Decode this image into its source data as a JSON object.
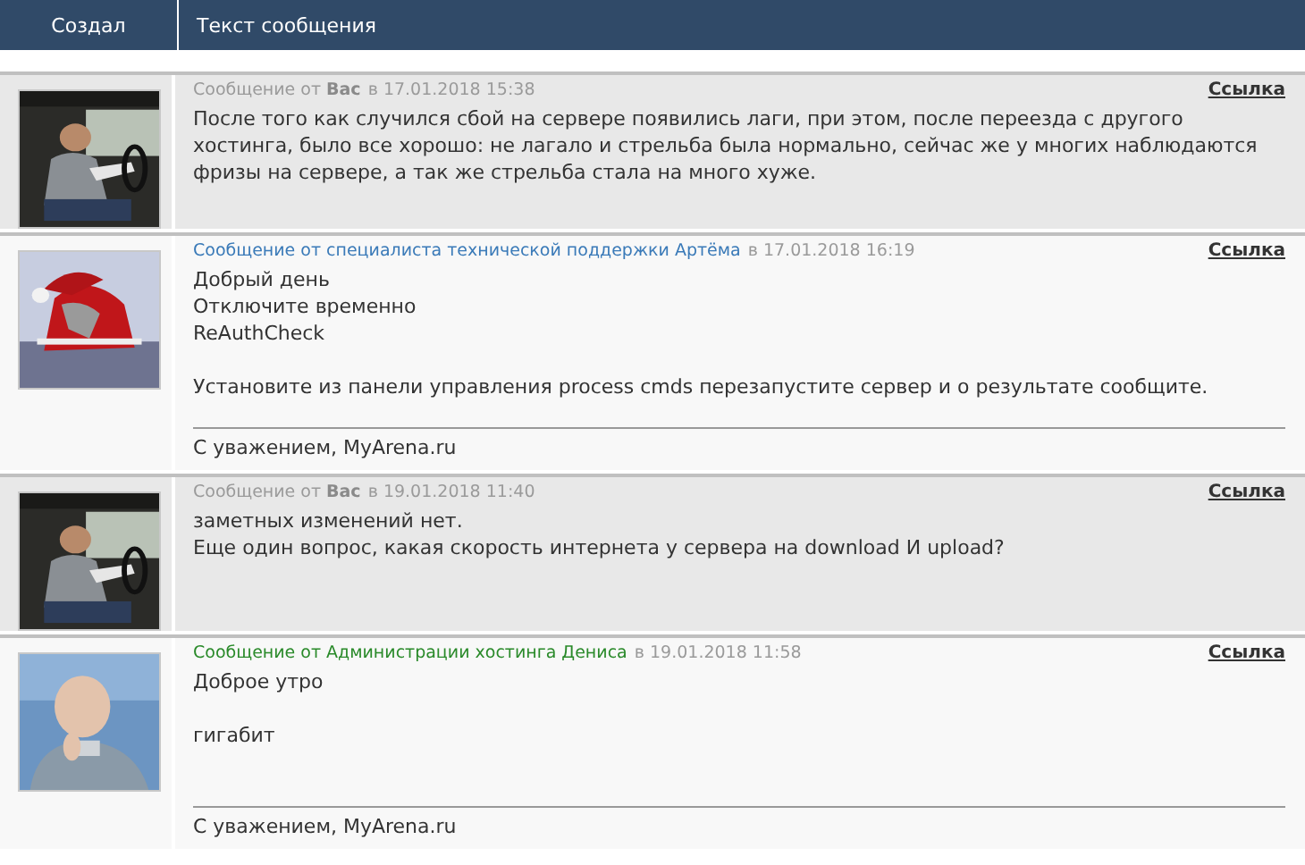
{
  "table": {
    "columns": [
      "Создал",
      "Текст сообщения"
    ]
  },
  "messages": [
    {
      "kind": "user",
      "from": "Сообщение от **Вас**",
      "date": "в 17.01.2018 15:38",
      "link": "Ссылка",
      "paragraphs": [
        [
          "После того как случился сбой на сервере появились лаги, при этом, после переезда с другого хостинга, было все хорошо: не лагало и стрельба была нормально, сейчас же у многих наблюдаются фризы на сервере, а так же стрельба стала на много хуже."
        ]
      ]
    },
    {
      "kind": "support",
      "from": "Сообщение от специалиста технической поддержки Артёма",
      "date": "в 17.01.2018 16:19",
      "link": "Ссылка",
      "paragraphs": [
        [
          "Добрый день",
          "Отключите временно",
          "ReAuthCheck"
        ],
        [
          "Установите из панели управления process cmds перезапустите сервер и о результате сообщите."
        ]
      ],
      "signature": "С уважением, MyArena.ru"
    },
    {
      "kind": "user",
      "from": "Сообщение от **Вас**",
      "date": "в 19.01.2018 11:40",
      "link": "Ссылка",
      "paragraphs": [
        [
          "заметных изменений нет.",
          "Еще один вопрос, какая скорость интернета у сервера на download И upload?"
        ]
      ]
    },
    {
      "kind": "admin",
      "from": "Сообщение от Администрации хостинга Дениса",
      "date": "в 19.01.2018 11:58",
      "link": "Ссылка",
      "paragraphs": [
        [
          "Доброе утро"
        ],
        [
          "гигабит"
        ]
      ],
      "signature": "С уважением, MyArena.ru"
    }
  ]
}
